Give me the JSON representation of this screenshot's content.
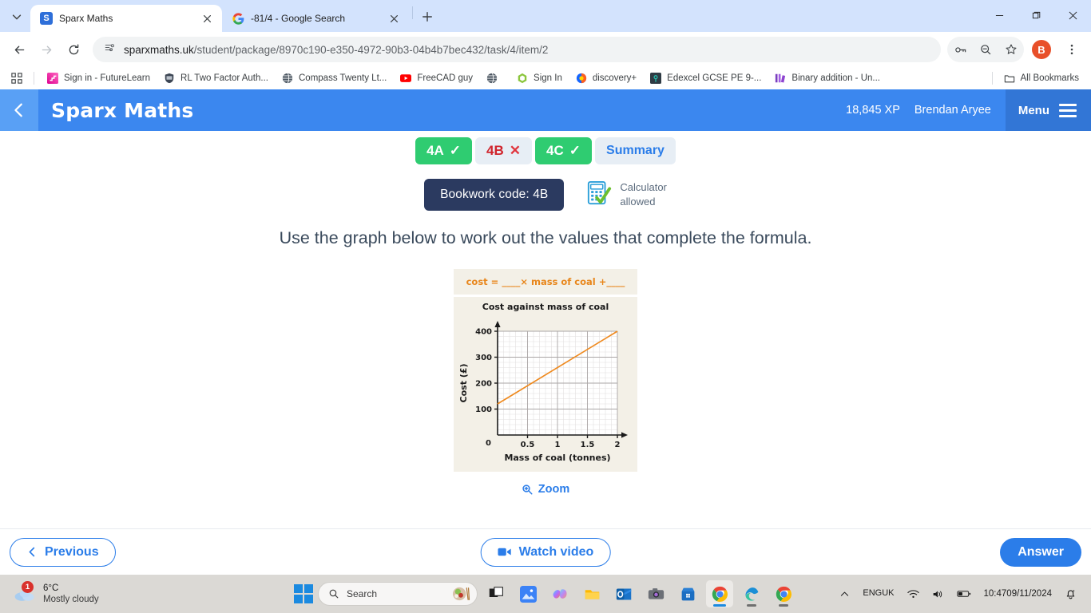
{
  "browser": {
    "tabs": [
      {
        "title": "Sparx Maths",
        "favicon": "sparx-icon",
        "active": true
      },
      {
        "title": "-81/4 - Google Search",
        "favicon": "google-icon",
        "active": false
      }
    ],
    "new_tab_label": "+",
    "url_host": "sparxmaths.uk",
    "url_path": "/student/package/8970c190-e350-4972-90b3-04b4b7bec432/task/4/item/2",
    "profile_initial": "B",
    "bookmarks": [
      {
        "label": "Sign in - FutureLearn",
        "icon": "futurelearn-icon"
      },
      {
        "label": "RL Two Factor Auth...",
        "icon": "shield-icon"
      },
      {
        "label": "Compass Twenty Lt...",
        "icon": "globe-icon"
      },
      {
        "label": "FreeCAD guy",
        "icon": "youtube-icon"
      },
      {
        "label": "",
        "icon": "globe-icon"
      },
      {
        "label": "Sign In",
        "icon": "hexagon-icon"
      },
      {
        "label": "discovery+",
        "icon": "discovery-icon"
      },
      {
        "label": "Edexcel GCSE PE 9-...",
        "icon": "lock-icon"
      },
      {
        "label": "Binary addition - Un...",
        "icon": "bars-icon"
      }
    ],
    "all_bookmarks_label": "All Bookmarks"
  },
  "app": {
    "brand": "Sparx Maths",
    "xp": "18,845 XP",
    "user": "Brendan Aryee",
    "menu_label": "Menu",
    "chips": [
      {
        "label": "4A",
        "state": "done",
        "mark": "✓"
      },
      {
        "label": "4B",
        "state": "wrong",
        "mark": "✕"
      },
      {
        "label": "4C",
        "state": "done",
        "mark": "✓"
      },
      {
        "label": "Summary",
        "state": "summary",
        "mark": ""
      }
    ],
    "bookwork_code": "Bookwork code: 4B",
    "calculator_line1": "Calculator",
    "calculator_line2": "allowed",
    "question": "Use the graph below to work out the values that complete the formula.",
    "zoom_label": "Zoom",
    "previous_label": "Previous",
    "watch_video_label": "Watch video",
    "answer_label": "Answer",
    "accent_blue": "#2b7de9",
    "appbar_blue": "#3b87ef",
    "orange": "#e8861b"
  },
  "chart_data": {
    "type": "line",
    "title": "Cost against mass of coal",
    "formula_prefix": "cost =",
    "formula_blank1": "____",
    "formula_mid": "× mass of coal +",
    "formula_blank2": "____",
    "xlabel": "Mass of coal (tonnes)",
    "ylabel": "Cost (£)",
    "xlim": [
      0,
      2.1
    ],
    "ylim": [
      0,
      420
    ],
    "xticks": [
      0,
      0.5,
      1,
      1.5,
      2
    ],
    "xtick_labels": [
      "0",
      "0.5",
      "1",
      "1.5",
      "2"
    ],
    "yticks": [
      0,
      100,
      200,
      300,
      400
    ],
    "ytick_labels": [
      "0",
      "100",
      "200",
      "300",
      "400"
    ],
    "x_minor_step": 0.1,
    "y_minor_step": 20,
    "grid": true,
    "legend": "none",
    "series": [
      {
        "name": "cost",
        "color": "#ef8a1f",
        "points": [
          [
            0,
            120
          ],
          [
            2,
            400
          ]
        ],
        "intercept": 120,
        "slope": 140
      }
    ]
  },
  "taskbar": {
    "weather_temp": "6°C",
    "weather_desc": "Mostly cloudy",
    "weather_badge": "1",
    "search_placeholder": "Search",
    "apps": [
      {
        "name": "task-view-icon"
      },
      {
        "name": "photos-icon"
      },
      {
        "name": "copilot-icon"
      },
      {
        "name": "file-explorer-icon"
      },
      {
        "name": "outlook-icon"
      },
      {
        "name": "camera-icon"
      },
      {
        "name": "microsoft-store-icon"
      },
      {
        "name": "chrome-icon"
      },
      {
        "name": "edge-icon"
      },
      {
        "name": "chrome-icon"
      }
    ],
    "lang_line1": "ENG",
    "lang_line2": "UK",
    "time": "10:47",
    "date": "09/11/2024"
  }
}
